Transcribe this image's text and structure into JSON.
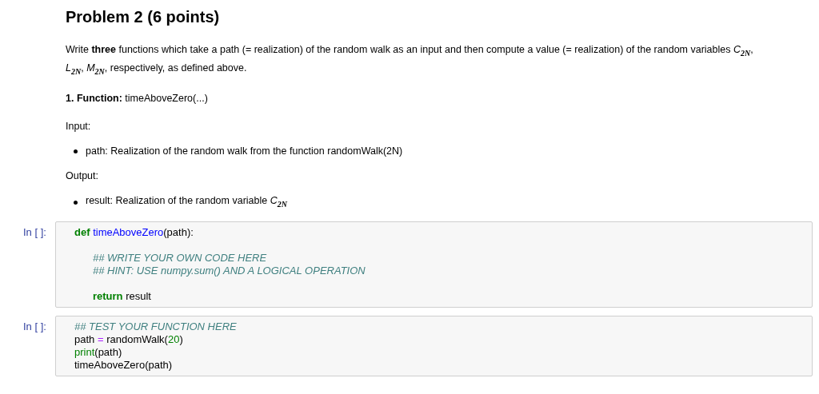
{
  "heading": "Problem 2 (6 points)",
  "blocks": [
    {
      "kind": "para",
      "text": "Write **three** functions which take a path (= realization) of the random walk as an input and then compute a value (= realization) of the random variables *C*$_{2N}$, *L*$_{2N}$, *M*$_{2N}$, respectively, as defined above."
    },
    {
      "kind": "para",
      "text": "**1. Function:** timeAboveZero(...)"
    },
    {
      "kind": "para",
      "text": "Input:"
    },
    {
      "kind": "bullet",
      "text": "path: Realization of the random walk from the function randomWalk(2N)"
    },
    {
      "kind": "para",
      "text": "Output:"
    },
    {
      "kind": "bullet",
      "text": "result: Realization of the random variable *C*$_{2N}$"
    }
  ],
  "cells": [
    {
      "prompt": "In [ ]:",
      "lines": [
        {
          "kind": "code",
          "indented": false,
          "tokens": [
            {
              "kind": "keyword",
              "text": "def "
            },
            {
              "kind": "funcname",
              "text": "timeAboveZero"
            },
            {
              "kind": "plain",
              "text": "(path):"
            }
          ]
        },
        {
          "kind": "blank"
        },
        {
          "kind": "code",
          "indented": true,
          "tokens": [
            {
              "kind": "comment",
              "text": "## WRITE YOUR OWN CODE HERE"
            }
          ]
        },
        {
          "kind": "code",
          "indented": true,
          "tokens": [
            {
              "kind": "comment",
              "text": "## HINT: USE numpy.sum() AND A LOGICAL OPERATION"
            }
          ]
        },
        {
          "kind": "blank"
        },
        {
          "kind": "code",
          "indented": true,
          "tokens": [
            {
              "kind": "keyword",
              "text": "return"
            },
            {
              "kind": "plain",
              "text": " result"
            }
          ]
        }
      ]
    },
    {
      "prompt": "In [ ]:",
      "lines": [
        {
          "kind": "code",
          "indented": false,
          "tokens": [
            {
              "kind": "comment",
              "text": "## TEST YOUR FUNCTION HERE"
            }
          ]
        },
        {
          "kind": "code",
          "indented": false,
          "tokens": [
            {
              "kind": "plain",
              "text": "path "
            },
            {
              "kind": "operator",
              "text": "="
            },
            {
              "kind": "plain",
              "text": " randomWalk("
            },
            {
              "kind": "number",
              "text": "20"
            },
            {
              "kind": "plain",
              "text": ")"
            }
          ]
        },
        {
          "kind": "code",
          "indented": false,
          "tokens": [
            {
              "kind": "builtin",
              "text": "print"
            },
            {
              "kind": "plain",
              "text": "(path)"
            }
          ]
        },
        {
          "kind": "code",
          "indented": false,
          "tokens": [
            {
              "kind": "plain",
              "text": "timeAboveZero(path)"
            }
          ]
        }
      ]
    }
  ]
}
